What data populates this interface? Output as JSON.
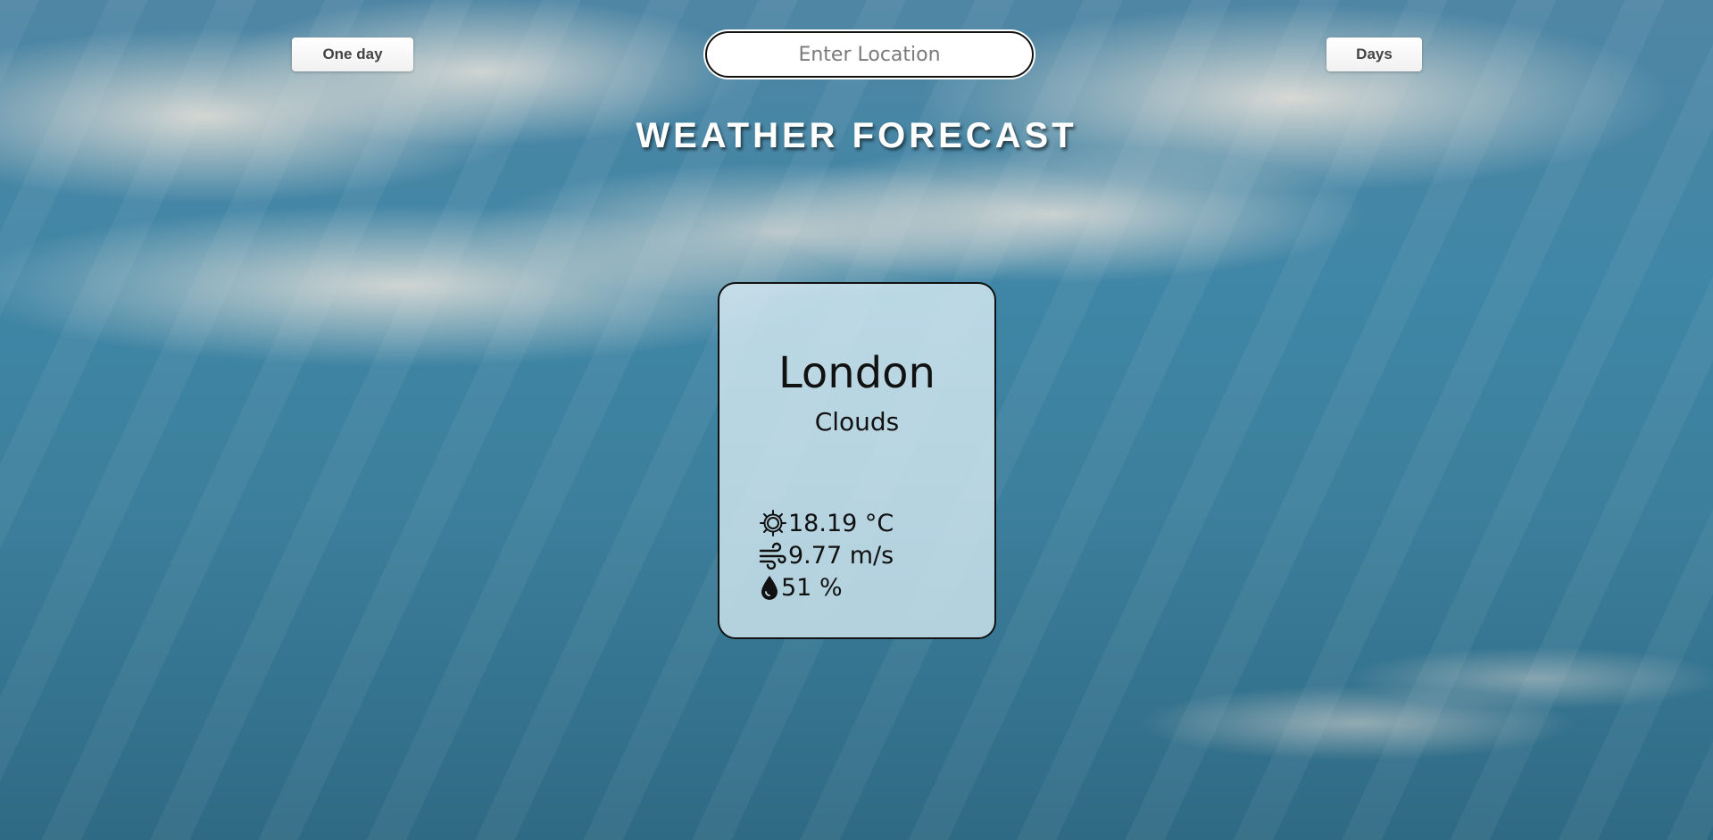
{
  "header": {
    "one_day_label": "One day",
    "days_label": "Days",
    "search_placeholder": "Enter Location",
    "title": "WEATHER FORECAST"
  },
  "weather": {
    "city": "London",
    "condition": "Clouds",
    "temperature": "18.19 °C",
    "wind": "9.77 m/s",
    "humidity": "51 %"
  },
  "icons": {
    "temperature": "sun-gear-icon",
    "wind": "wind-icon",
    "humidity": "water-drop-icon"
  }
}
